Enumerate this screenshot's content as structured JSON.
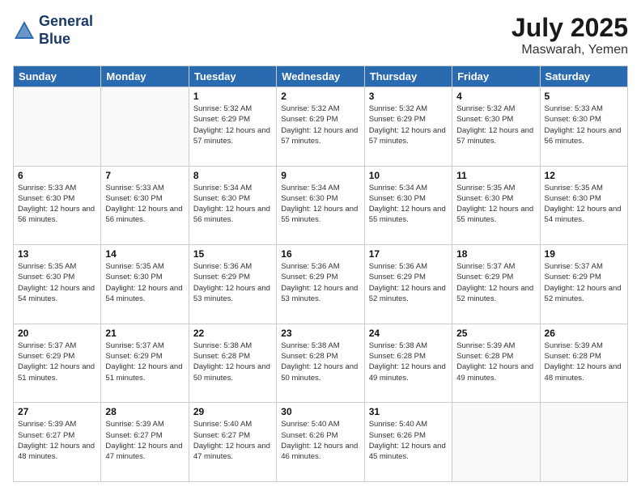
{
  "header": {
    "logo_line1": "General",
    "logo_line2": "Blue",
    "month": "July 2025",
    "location": "Maswarah, Yemen"
  },
  "days_of_week": [
    "Sunday",
    "Monday",
    "Tuesday",
    "Wednesday",
    "Thursday",
    "Friday",
    "Saturday"
  ],
  "weeks": [
    [
      {
        "day": "",
        "sunrise": "",
        "sunset": "",
        "daylight": ""
      },
      {
        "day": "",
        "sunrise": "",
        "sunset": "",
        "daylight": ""
      },
      {
        "day": "1",
        "sunrise": "Sunrise: 5:32 AM",
        "sunset": "Sunset: 6:29 PM",
        "daylight": "Daylight: 12 hours and 57 minutes."
      },
      {
        "day": "2",
        "sunrise": "Sunrise: 5:32 AM",
        "sunset": "Sunset: 6:29 PM",
        "daylight": "Daylight: 12 hours and 57 minutes."
      },
      {
        "day": "3",
        "sunrise": "Sunrise: 5:32 AM",
        "sunset": "Sunset: 6:29 PM",
        "daylight": "Daylight: 12 hours and 57 minutes."
      },
      {
        "day": "4",
        "sunrise": "Sunrise: 5:32 AM",
        "sunset": "Sunset: 6:30 PM",
        "daylight": "Daylight: 12 hours and 57 minutes."
      },
      {
        "day": "5",
        "sunrise": "Sunrise: 5:33 AM",
        "sunset": "Sunset: 6:30 PM",
        "daylight": "Daylight: 12 hours and 56 minutes."
      }
    ],
    [
      {
        "day": "6",
        "sunrise": "Sunrise: 5:33 AM",
        "sunset": "Sunset: 6:30 PM",
        "daylight": "Daylight: 12 hours and 56 minutes."
      },
      {
        "day": "7",
        "sunrise": "Sunrise: 5:33 AM",
        "sunset": "Sunset: 6:30 PM",
        "daylight": "Daylight: 12 hours and 56 minutes."
      },
      {
        "day": "8",
        "sunrise": "Sunrise: 5:34 AM",
        "sunset": "Sunset: 6:30 PM",
        "daylight": "Daylight: 12 hours and 56 minutes."
      },
      {
        "day": "9",
        "sunrise": "Sunrise: 5:34 AM",
        "sunset": "Sunset: 6:30 PM",
        "daylight": "Daylight: 12 hours and 55 minutes."
      },
      {
        "day": "10",
        "sunrise": "Sunrise: 5:34 AM",
        "sunset": "Sunset: 6:30 PM",
        "daylight": "Daylight: 12 hours and 55 minutes."
      },
      {
        "day": "11",
        "sunrise": "Sunrise: 5:35 AM",
        "sunset": "Sunset: 6:30 PM",
        "daylight": "Daylight: 12 hours and 55 minutes."
      },
      {
        "day": "12",
        "sunrise": "Sunrise: 5:35 AM",
        "sunset": "Sunset: 6:30 PM",
        "daylight": "Daylight: 12 hours and 54 minutes."
      }
    ],
    [
      {
        "day": "13",
        "sunrise": "Sunrise: 5:35 AM",
        "sunset": "Sunset: 6:30 PM",
        "daylight": "Daylight: 12 hours and 54 minutes."
      },
      {
        "day": "14",
        "sunrise": "Sunrise: 5:35 AM",
        "sunset": "Sunset: 6:30 PM",
        "daylight": "Daylight: 12 hours and 54 minutes."
      },
      {
        "day": "15",
        "sunrise": "Sunrise: 5:36 AM",
        "sunset": "Sunset: 6:29 PM",
        "daylight": "Daylight: 12 hours and 53 minutes."
      },
      {
        "day": "16",
        "sunrise": "Sunrise: 5:36 AM",
        "sunset": "Sunset: 6:29 PM",
        "daylight": "Daylight: 12 hours and 53 minutes."
      },
      {
        "day": "17",
        "sunrise": "Sunrise: 5:36 AM",
        "sunset": "Sunset: 6:29 PM",
        "daylight": "Daylight: 12 hours and 52 minutes."
      },
      {
        "day": "18",
        "sunrise": "Sunrise: 5:37 AM",
        "sunset": "Sunset: 6:29 PM",
        "daylight": "Daylight: 12 hours and 52 minutes."
      },
      {
        "day": "19",
        "sunrise": "Sunrise: 5:37 AM",
        "sunset": "Sunset: 6:29 PM",
        "daylight": "Daylight: 12 hours and 52 minutes."
      }
    ],
    [
      {
        "day": "20",
        "sunrise": "Sunrise: 5:37 AM",
        "sunset": "Sunset: 6:29 PM",
        "daylight": "Daylight: 12 hours and 51 minutes."
      },
      {
        "day": "21",
        "sunrise": "Sunrise: 5:37 AM",
        "sunset": "Sunset: 6:29 PM",
        "daylight": "Daylight: 12 hours and 51 minutes."
      },
      {
        "day": "22",
        "sunrise": "Sunrise: 5:38 AM",
        "sunset": "Sunset: 6:28 PM",
        "daylight": "Daylight: 12 hours and 50 minutes."
      },
      {
        "day": "23",
        "sunrise": "Sunrise: 5:38 AM",
        "sunset": "Sunset: 6:28 PM",
        "daylight": "Daylight: 12 hours and 50 minutes."
      },
      {
        "day": "24",
        "sunrise": "Sunrise: 5:38 AM",
        "sunset": "Sunset: 6:28 PM",
        "daylight": "Daylight: 12 hours and 49 minutes."
      },
      {
        "day": "25",
        "sunrise": "Sunrise: 5:39 AM",
        "sunset": "Sunset: 6:28 PM",
        "daylight": "Daylight: 12 hours and 49 minutes."
      },
      {
        "day": "26",
        "sunrise": "Sunrise: 5:39 AM",
        "sunset": "Sunset: 6:28 PM",
        "daylight": "Daylight: 12 hours and 48 minutes."
      }
    ],
    [
      {
        "day": "27",
        "sunrise": "Sunrise: 5:39 AM",
        "sunset": "Sunset: 6:27 PM",
        "daylight": "Daylight: 12 hours and 48 minutes."
      },
      {
        "day": "28",
        "sunrise": "Sunrise: 5:39 AM",
        "sunset": "Sunset: 6:27 PM",
        "daylight": "Daylight: 12 hours and 47 minutes."
      },
      {
        "day": "29",
        "sunrise": "Sunrise: 5:40 AM",
        "sunset": "Sunset: 6:27 PM",
        "daylight": "Daylight: 12 hours and 47 minutes."
      },
      {
        "day": "30",
        "sunrise": "Sunrise: 5:40 AM",
        "sunset": "Sunset: 6:26 PM",
        "daylight": "Daylight: 12 hours and 46 minutes."
      },
      {
        "day": "31",
        "sunrise": "Sunrise: 5:40 AM",
        "sunset": "Sunset: 6:26 PM",
        "daylight": "Daylight: 12 hours and 45 minutes."
      },
      {
        "day": "",
        "sunrise": "",
        "sunset": "",
        "daylight": ""
      },
      {
        "day": "",
        "sunrise": "",
        "sunset": "",
        "daylight": ""
      }
    ]
  ]
}
